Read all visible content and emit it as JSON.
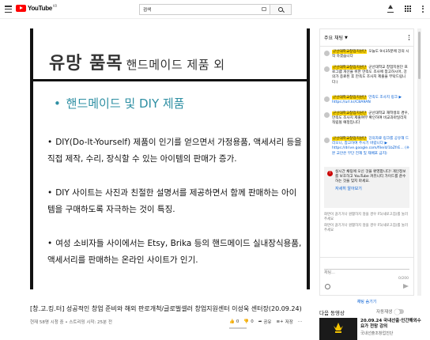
{
  "header": {
    "logo_text": "YouTube",
    "logo_region": "KR",
    "search_value": "검색",
    "search_icon": "search-icon",
    "icons": [
      "upload-icon",
      "apps-grid-icon",
      "more-vert-icon"
    ]
  },
  "slide": {
    "title": "유망 품목",
    "title_sub": "핸드메이드 제품 외",
    "subheading": "핸드메이드 및 DIY 제품",
    "bullet": "•",
    "paragraphs": [
      "DIY(Do-It-Yourself) 제품이 인기를 얻으면서 가정용품, 액세서리 등을 직접 제작, 수리, 장식할 수 있는 아이템의 판매가 증가.",
      "DIY 사이트는 사진과 친절한 설명서를 제공하면서 함께 판매하는 아이템을 구매하도록 자극하는 것이 특징.",
      "여성 소비자들 사이에서는 Etsy, Brika 등의 핸드메이드 실내장식용품, 액세서리를 판매하는 온라인 사이트가 인기."
    ],
    "accent_color": "#2e8fa3"
  },
  "video": {
    "title": "[창.고.킹.터] 성공적인 창업 준비와 해외 판로개척/글로벌셀러 창업지원센터 이성욱 센터장(20.09.24)",
    "meta": "현재 58명 시청 중 • 스트리밍 시작: 25분 전",
    "actions": {
      "like": "0",
      "dislike": "0",
      "share": "공유",
      "save": "저장"
    }
  },
  "chat": {
    "header": "주요 채팅",
    "messages": [
      {
        "author": "군산대학교창업지원단",
        "text": "오늘도 9시35분에 강의 시작 하겠습니다"
      },
      {
        "author": "군산대학교창업지원단",
        "text": "군산대학교 창업지원단 프로그램 개선을 위한 만족도 조사에 참고하시어, 강의가 종료된 후 만족도 조사지 제출을 부탁드립니다:)"
      },
      {
        "author": "군산대학교창업지원단",
        "text": "만족도 조사지 링크 ▶ https://url.kr/C8A9AN"
      },
      {
        "author": "군산대학교창업지원단",
        "text": "군산대학교 재학생의 경우, 만족도 조사지 제출여부 확인하여 비교과마일리지 적립될 예정입니다"
      },
      {
        "author": "군산대학교창업지원단",
        "text": "강의자료 링크를 공유해 드리오니, 참고하여 주시기 바랍니다 ▶ https://drive.google.com/file/d/1bZfrE... (※ 본 교안은 무단 전재 및 재배포 금지)"
      }
    ],
    "warning": "실시간 채팅에 오신 것을 환영합니다! 개인정보를 보호하고 YouTube 커뮤니티 가이드를 준수하는 것을 잊지 마세요.",
    "warning_link": "자세히 알아보기",
    "notices": [
      "화면이 끊기거나 원활하지 않을 경우 F5(새로고침)를 눌러주세요",
      "화면이 끊기거나 원활하지 않을 경우 F5(새로고침)를 눌러주세요"
    ],
    "input_placeholder": "채팅...",
    "input_count": "0/200",
    "hide_label": "채팅 숨기기"
  },
  "sidebar": {
    "up_next": "다음 동영상",
    "autoplay": "자동재생",
    "next_title": "20.09.24 국내선출·인간해외수요가 전망 강의",
    "next_channel": "국내선출조창업진단"
  }
}
